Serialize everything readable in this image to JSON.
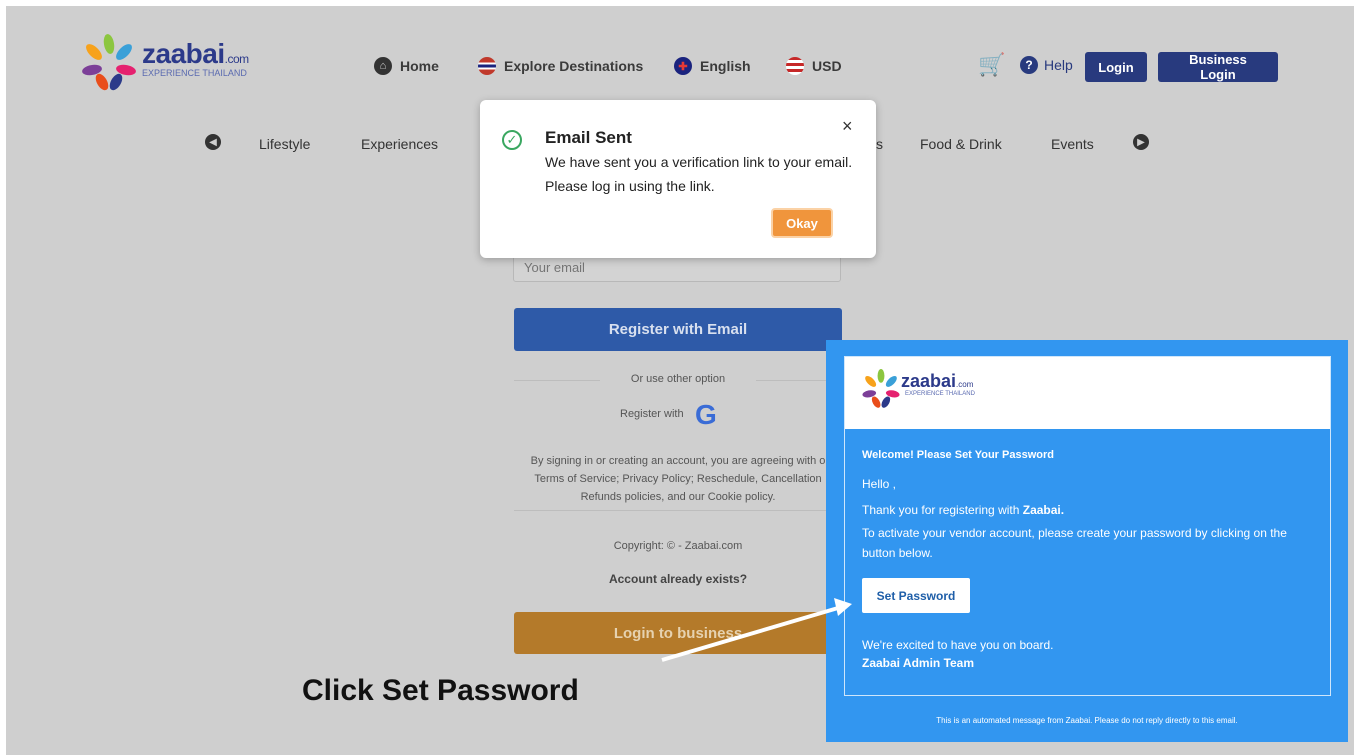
{
  "header": {
    "logo": {
      "word": "zaabai",
      "suffix": ".com",
      "tagline": "EXPERIENCE THAILAND"
    },
    "nav": [
      {
        "label": "Home",
        "icon": "home-icon"
      },
      {
        "label": "Explore Destinations",
        "icon": "thailand-flag-icon"
      },
      {
        "label": "English",
        "icon": "uk-flag-icon"
      },
      {
        "label": "USD",
        "icon": "us-flag-icon"
      }
    ],
    "help_label": "Help",
    "login_label": "Login",
    "business_login_label": "Business Login"
  },
  "categories": [
    "Lifestyle",
    "Experiences",
    "s",
    "Food & Drink",
    "Events"
  ],
  "form": {
    "email_placeholder": "Your email",
    "register_label": "Register with Email",
    "or_text": "Or use other option",
    "register_with": "Register with",
    "legal_line1": "By signing in or creating an account, you are agreeing with o",
    "legal_line2": "Terms of Service; Privacy Policy; Reschedule, Cancellation",
    "legal_line3": "Refunds policies, and our Cookie policy.",
    "copyright": "Copyright: © - Zaabai.com",
    "exists": "Account already exists?",
    "business_label": "Login to business"
  },
  "modal": {
    "title": "Email Sent",
    "message": "We have sent you a verification link to your email. Please log in using the link.",
    "close": "×",
    "okay": "Okay"
  },
  "email_preview": {
    "logo_word": "zaabai",
    "logo_suffix": ".com",
    "logo_tagline": "EXPERIENCE THAILAND",
    "title": "Welcome! Please Set Your Password",
    "hello": "Hello ,",
    "thanks_prefix": "Thank you for registering with ",
    "thanks_brand": "Zaabai.",
    "activate": "To activate your vendor account, please create your password by clicking on the button below.",
    "set_password": "Set Password",
    "excited": "We're excited to have you on board.",
    "team": "Zaabai Admin Team",
    "footer": "This is an automated message from Zaabai. Please do not reply directly to this email."
  },
  "annotation": "Click Set Password",
  "colors": {
    "brand_navy": "#283a7e",
    "email_blue": "#3296f0",
    "okay_orange": "#f0953c"
  }
}
